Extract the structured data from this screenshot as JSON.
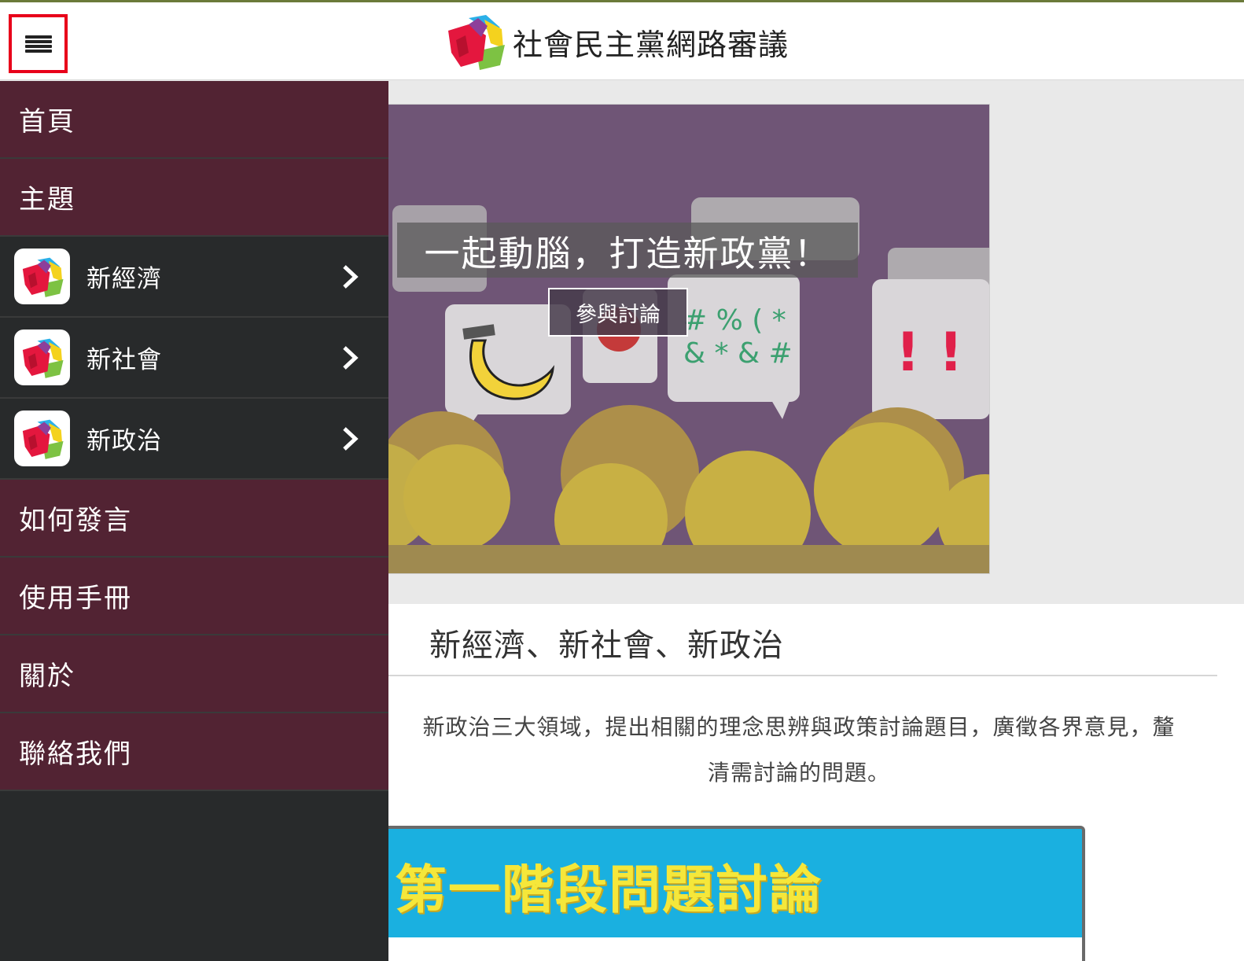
{
  "header": {
    "brand_title": "社會民主黨網路審議",
    "menu_icon": "hamburger-menu-icon",
    "highlight_color": "#e8001a"
  },
  "drawer": {
    "background": "#282a2b",
    "primary_color": "#522333",
    "items_top": [
      {
        "label": "首頁"
      },
      {
        "label": "主題"
      }
    ],
    "topics": [
      {
        "label": "新經濟",
        "icon": "party-logo-icon"
      },
      {
        "label": "新社會",
        "icon": "party-logo-icon"
      },
      {
        "label": "新政治",
        "icon": "party-logo-icon"
      }
    ],
    "items_bottom": [
      {
        "label": "如何發言"
      },
      {
        "label": "使用手冊"
      },
      {
        "label": "關於"
      },
      {
        "label": "聯絡我們"
      }
    ]
  },
  "hero": {
    "caption": "一起動腦，打造新政黨！",
    "button_label": "參與討論",
    "bubble_symbols_1": "# % ( *",
    "bubble_symbols_2": "& * & #",
    "bubble_exclaim": "! !"
  },
  "section": {
    "title": "新經濟、新社會、新政治",
    "description_line1": "新政治三大領域，提出相關的理念思辨與政策討論題目，廣徵各界意見，釐",
    "description_line2": "清需討論的問題。"
  },
  "stage": {
    "title": "第一階段問題討論",
    "background": "#1ab0e0",
    "text_color": "#f5e73a"
  }
}
